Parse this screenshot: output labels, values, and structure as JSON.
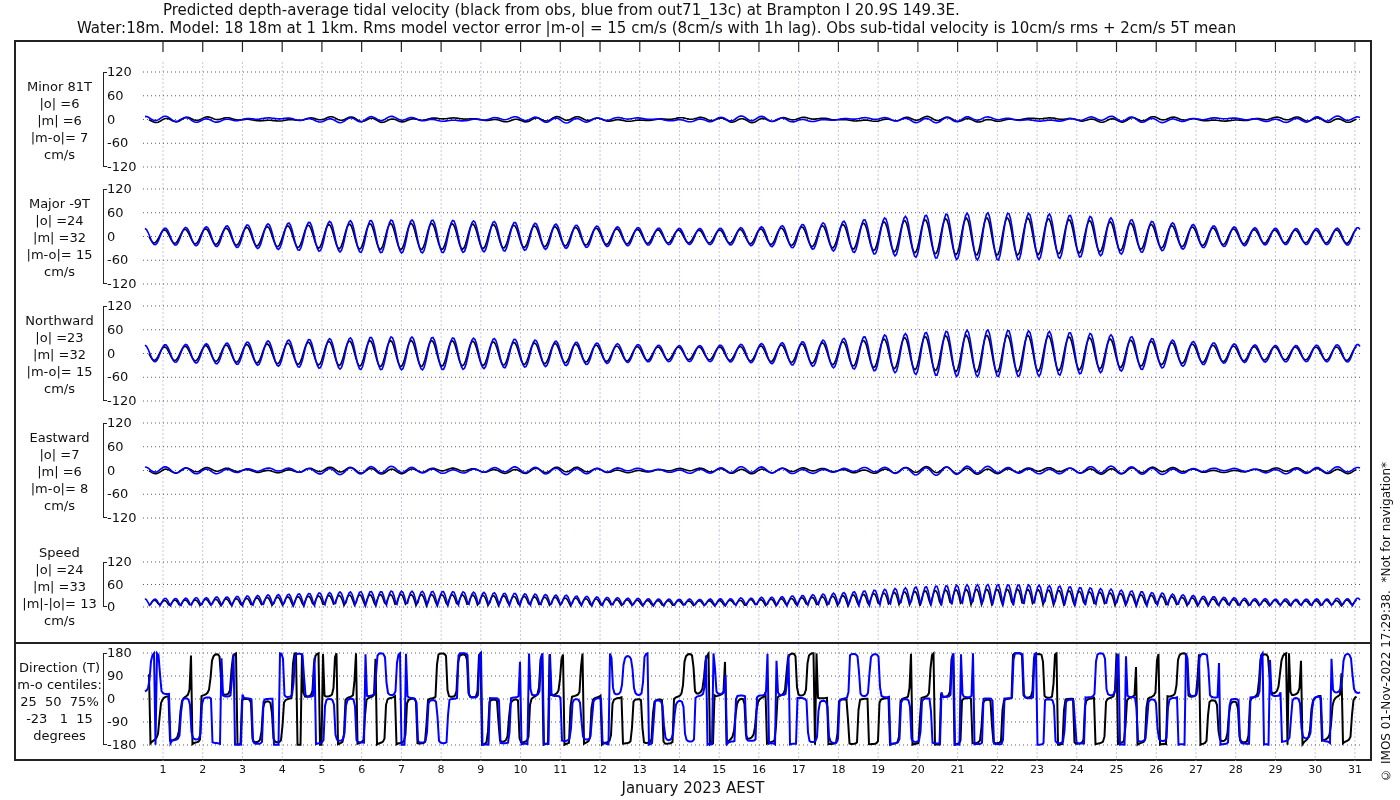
{
  "title_lines": [
    "Predicted depth-average tidal velocity (black from obs, blue from out71_13c) at Brampton I 20.9S 149.3E.",
    "Water:18m. Model: 18 18m at 1 1km. Rms model vector error |m-o| = 15 cm/s (8cm/s with 1h lag). Obs sub-tidal velocity is 10cm/s rms + 2cm/s 5T mean"
  ],
  "panels": [
    {
      "kind": "minor",
      "label_lines": [
        "Minor 81T",
        "|o| =6",
        "|m| =6",
        "|m-o|= 7",
        "cm/s"
      ],
      "yticks": [
        "120",
        "60",
        "0",
        "-60",
        "-120"
      ]
    },
    {
      "kind": "major",
      "label_lines": [
        "Major -9T",
        "|o| =24",
        "|m| =32",
        "|m-o|= 15",
        "cm/s"
      ],
      "yticks": [
        "120",
        "60",
        "0",
        "-60",
        "-120"
      ]
    },
    {
      "kind": "north",
      "label_lines": [
        "Northward",
        "|o| =23",
        "|m| =32",
        "|m-o|= 15",
        "cm/s"
      ],
      "yticks": [
        "120",
        "60",
        "0",
        "-60",
        "-120"
      ]
    },
    {
      "kind": "east",
      "label_lines": [
        "Eastward",
        "|o| =7",
        "|m| =6",
        "|m-o|= 8",
        "cm/s"
      ],
      "yticks": [
        "120",
        "60",
        "0",
        "-60",
        "-120"
      ]
    },
    {
      "kind": "speed",
      "label_lines": [
        "Speed",
        "|o| =24",
        "|m| =33",
        "|m|-|o|= 13",
        "cm/s"
      ],
      "yticks": [
        "120",
        "60",
        "0"
      ]
    },
    {
      "kind": "direction",
      "label_lines": [
        "Direction (T)",
        "m-o centiles:",
        "25  50  75%",
        "-23   1  15",
        "degrees"
      ],
      "yticks": [
        "180",
        "90",
        "0",
        "-90",
        "-180"
      ]
    }
  ],
  "x_ticks": [
    "1",
    "2",
    "3",
    "4",
    "5",
    "6",
    "7",
    "8",
    "9",
    "10",
    "11",
    "12",
    "13",
    "14",
    "15",
    "16",
    "17",
    "18",
    "19",
    "20",
    "21",
    "22",
    "23",
    "24",
    "25",
    "26",
    "27",
    "28",
    "29",
    "30",
    "31"
  ],
  "xlabel": "January 2023 AEST",
  "side_note": "© IMOS 01-Nov-2022 17:29:38.  *Not for navigation*"
}
